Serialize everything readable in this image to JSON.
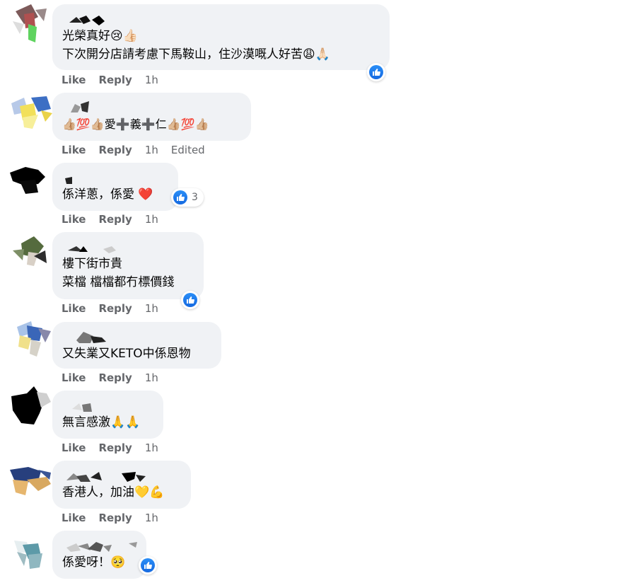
{
  "comments": [
    {
      "text": "光榮真好😢👍🏻\n下次開分店請考慮下馬鞍山，住沙漠嘅人好苦😩🙏🏻",
      "time": "1h",
      "edited": ""
    },
    {
      "text": "👍🏼💯👍🏼愛➕義➕仁👍🏼💯👍🏼",
      "time": "1h",
      "edited": "Edited"
    },
    {
      "text": "係洋蔥，係愛 ❤️",
      "time": "1h",
      "edited": "",
      "reaction_count": "3"
    },
    {
      "text": "樓下街市貴\n菜檔 檔檔都冇標價錢",
      "time": "1h",
      "edited": ""
    },
    {
      "text": "又失業又KETO中係恩物",
      "time": "1h",
      "edited": ""
    },
    {
      "text": "無言感激🙏🙏",
      "time": "1h",
      "edited": ""
    },
    {
      "text": "香港人，加油💛💪",
      "time": "1h",
      "edited": ""
    },
    {
      "text": "係愛呀！🥺",
      "time": "",
      "edited": ""
    }
  ],
  "labels": {
    "like": "Like",
    "reply": "Reply"
  },
  "colors": {
    "accent": "#1877f2",
    "bubble": "#f0f2f5",
    "meta": "#65676b"
  }
}
